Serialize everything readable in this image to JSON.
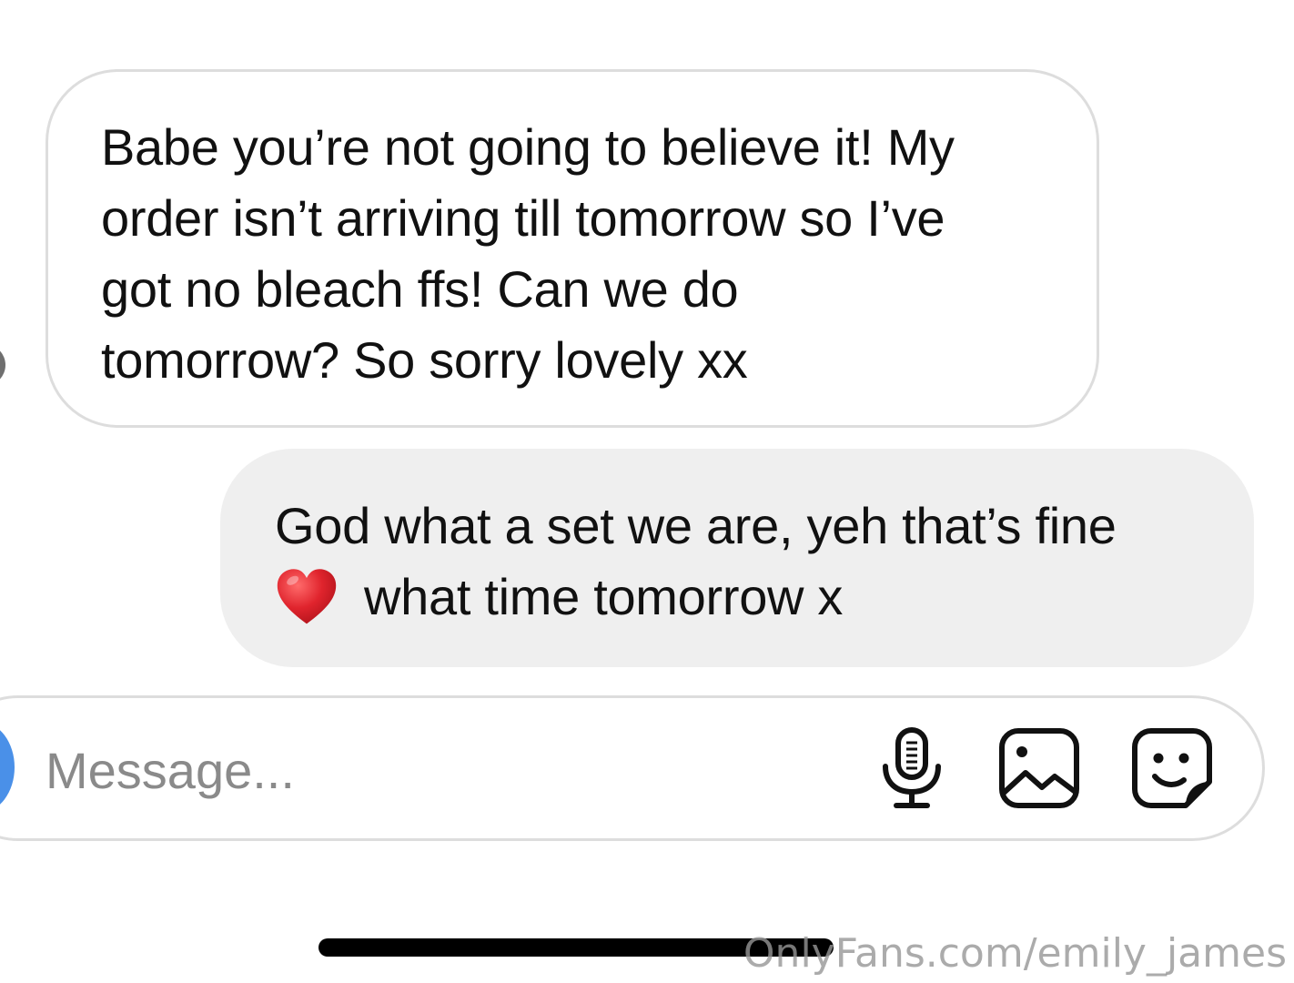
{
  "thread": {
    "incoming": {
      "text": "Babe you’re not going to believe it! My\norder isn’t arriving till tomorrow so I’ve\ngot no bleach ffs! Can we do\ntomorrow? So sorry lovely xx"
    },
    "outgoing": {
      "line1": "God what a set we are, yeh that’s fine",
      "line2": "what time tomorrow x",
      "emoji": "red-heart"
    }
  },
  "composer": {
    "placeholder": "Message...",
    "value": "",
    "icons": [
      "camera-icon",
      "microphone-icon",
      "image-gallery-icon",
      "sticker-icon"
    ],
    "accent": "#4a90e8"
  },
  "watermark": {
    "text": "OnlyFans.com/emily_james"
  },
  "colors": {
    "incoming_bubble_border": "#dddddd",
    "outgoing_bubble_bg": "#efefef",
    "heart": "#e0242d"
  }
}
